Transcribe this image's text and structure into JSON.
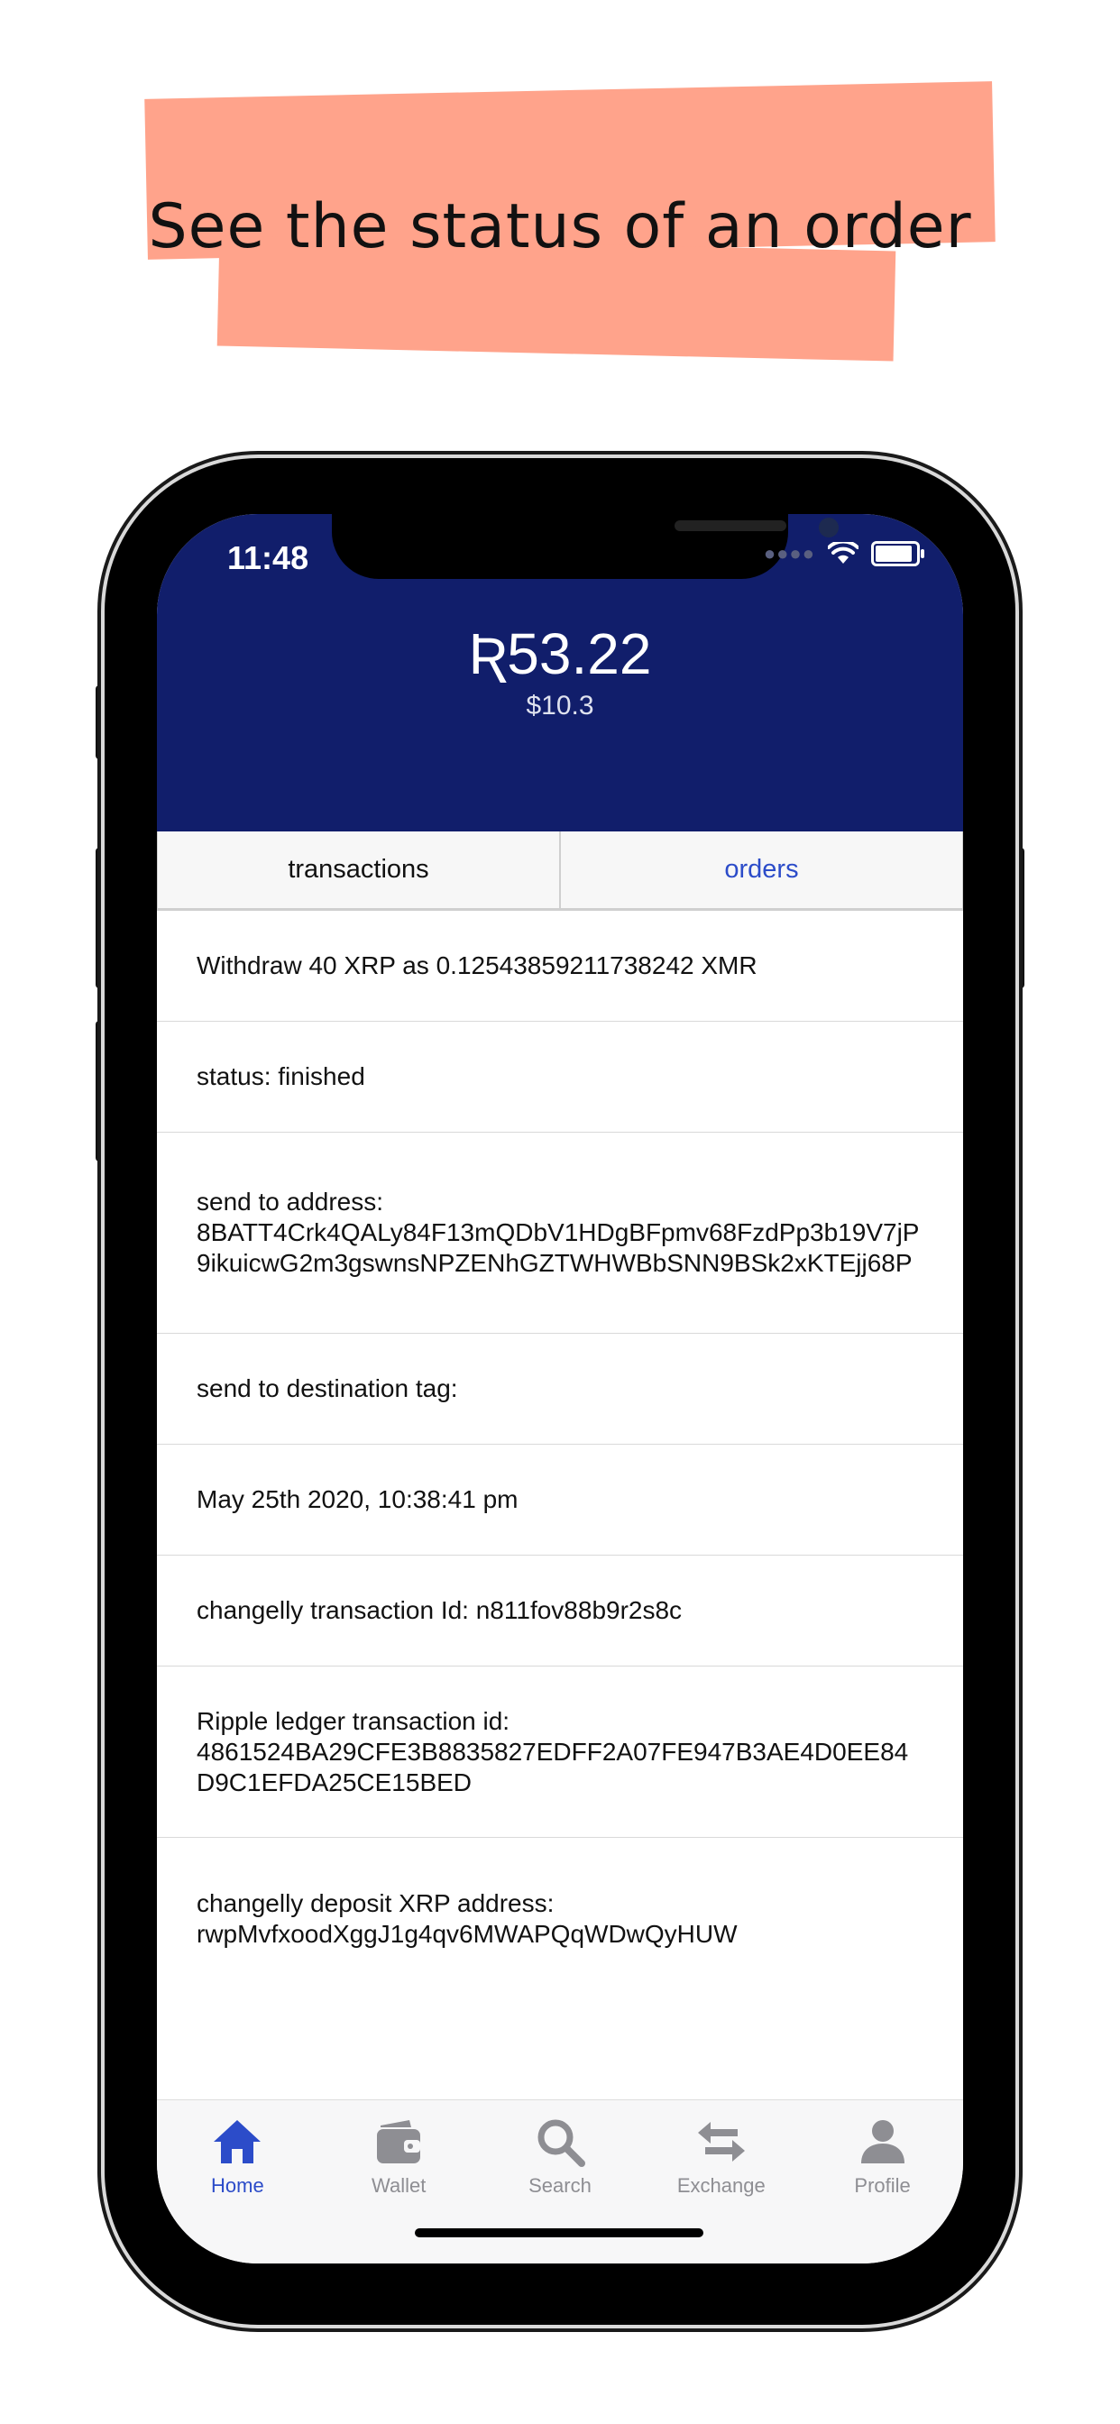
{
  "banner": {
    "headline": "See the status of an order"
  },
  "status_bar": {
    "time": "11:48"
  },
  "wallet": {
    "balance": "Ʀ53.22",
    "fiat": "$10.3"
  },
  "tabs": [
    {
      "label": "transactions",
      "active": false
    },
    {
      "label": "orders",
      "active": true
    }
  ],
  "order": {
    "title": "Withdraw 40 XRP as 0.12543859211738242 XMR",
    "status": "status:  finished",
    "send_address_label": "send to address:",
    "send_address": "8BATT4Crk4QALy84F13mQDbV1HDgBFpmv68FzdPp3b19V7jP9ikuicwG2m3gswnsNPZENhGZTWHWBbSNN9BSk2xKTEjj68P",
    "destination_tag": "send to destination tag:",
    "date": "May 25th 2020, 10:38:41 pm",
    "changelly_tx": "changelly transaction Id:  n811fov88b9r2s8c",
    "ripple_tx_label": "Ripple ledger transaction id:",
    "ripple_tx": "4861524BA29CFE3B8835827EDFF2A07FE947B3AE4D0EE84D9C1EFDA25CE15BED",
    "deposit_label": "changelly deposit XRP address:",
    "deposit_address": "rwpMvfxoodXggJ1g4qv6MWAPQqWDwQyHUW"
  },
  "tabbar": [
    {
      "label": "Home",
      "icon": "home-icon",
      "active": true
    },
    {
      "label": "Wallet",
      "icon": "wallet-icon",
      "active": false
    },
    {
      "label": "Search",
      "icon": "search-icon",
      "active": false
    },
    {
      "label": "Exchange",
      "icon": "exchange-icon",
      "active": false
    },
    {
      "label": "Profile",
      "icon": "profile-icon",
      "active": false
    }
  ],
  "colors": {
    "header_bg": "#111E6B",
    "accent": "#2C4CC9",
    "banner": "#FFA38B",
    "inactive": "#8E8E93"
  }
}
